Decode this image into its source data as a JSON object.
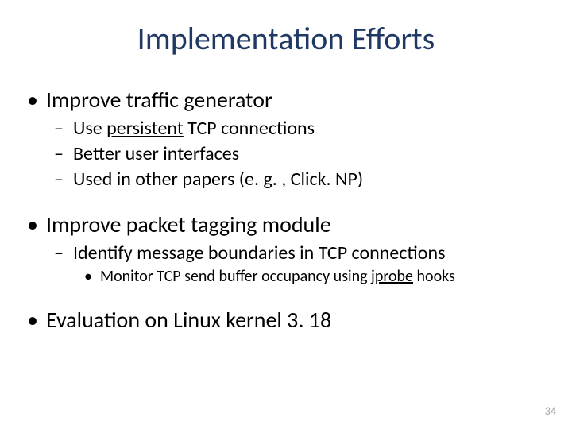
{
  "title": "Implementation Efforts",
  "b1": {
    "text": "Improve traffic generator"
  },
  "b1s1": {
    "pre": "Use ",
    "kw": "persistent",
    "post": " TCP connections"
  },
  "b1s2": {
    "text": "Better user interfaces"
  },
  "b1s3": {
    "text": "Used in other papers (e. g. , Click. NP)"
  },
  "b2": {
    "text": "Improve packet tagging module"
  },
  "b2s1": {
    "text": "Identify message boundaries in TCP connections"
  },
  "b2s1s1": {
    "pre": "Monitor TCP send buffer occupancy using ",
    "kw": "jprobe",
    "post": " hooks"
  },
  "b3": {
    "text": "Evaluation on Linux kernel 3. 18"
  },
  "page": "34"
}
